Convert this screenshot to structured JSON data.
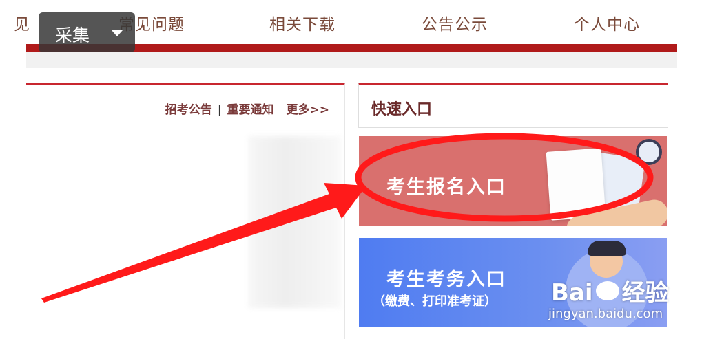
{
  "toolbar": {
    "collect_label": "采集"
  },
  "nav": {
    "items": [
      {
        "label": "见"
      },
      {
        "label": "常见问题"
      },
      {
        "label": "相关下载"
      },
      {
        "label": "公告公示"
      },
      {
        "label": "个人中心"
      }
    ]
  },
  "notices": {
    "link_recruit": "招考公告",
    "divider": "|",
    "link_important": "重要通知",
    "link_more": "更多>>"
  },
  "quick_entry": {
    "title": "快速入口",
    "register_label": "考生报名入口",
    "exam_label": "考生考务入口",
    "exam_sub": "（缴费、打印准考证）"
  },
  "watermark": {
    "brand_left": "Bai",
    "brand_right": "经验",
    "url": "jingyan.baidu.com"
  },
  "colors": {
    "nav_bar": "#b01a1a",
    "accent_red": "#c8262f",
    "register_banner": "#d9706e",
    "exam_banner": "#5b84f0",
    "annotation": "#ff1a1a"
  },
  "icons": [
    "caret-down-icon",
    "baidu-paw-icon"
  ]
}
